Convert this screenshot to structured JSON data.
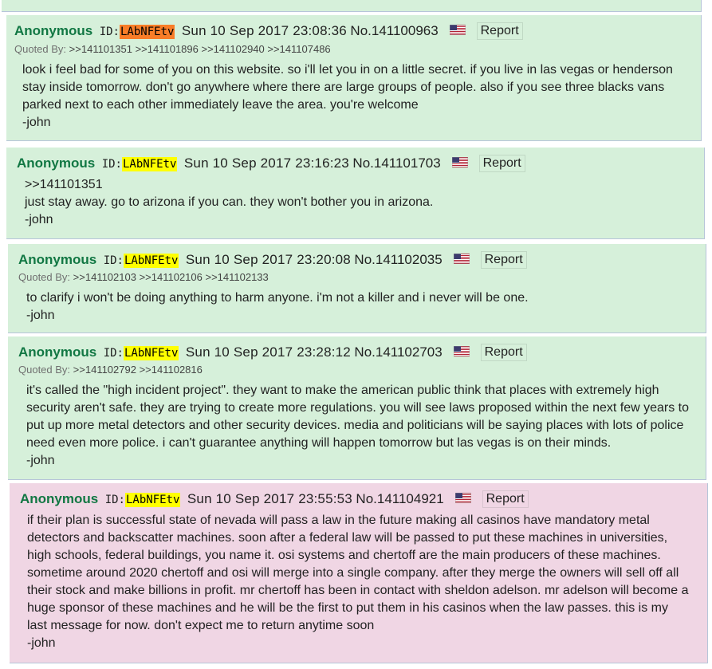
{
  "colors": {
    "post_bg_green": "#d6f0da",
    "post_bg_pink": "#f0d6e4",
    "name_green": "#117743",
    "id_orange": "#f97d28",
    "id_yellow": "#ffff00"
  },
  "posts": [
    {
      "name": "Anonymous",
      "id_label": "ID:",
      "id": "LAbNFEtv",
      "datetime": "Sun 10 Sep 2017 23:08:36",
      "post_no": "No.141100963",
      "flag_icon": "us-flag-icon",
      "report_label": "Report",
      "quoted_by_label": "Quoted By:",
      "quoted_by": ">>141101351 >>141101896 >>141102940 >>141107486",
      "lines": [
        "look i feel bad for some of you on this website. so i'll let you in on a little secret. if you live in las vegas or henderson",
        "stay inside tomorrow. don't go anywhere where there are large groups of people. also if you see three blacks vans",
        "parked next to each other immediately leave the area. you're welcome",
        "-john"
      ]
    },
    {
      "name": "Anonymous",
      "id_label": "ID:",
      "id": "LAbNFEtv",
      "datetime": "Sun 10 Sep 2017 23:16:23",
      "post_no": "No.141101703",
      "flag_icon": "us-flag-icon",
      "report_label": "Report",
      "quote_link": ">>141101351",
      "lines": [
        "just stay away. go to arizona if you can. they won't bother you in arizona.",
        "-john"
      ]
    },
    {
      "name": "Anonymous",
      "id_label": "ID:",
      "id": "LAbNFEtv",
      "datetime": "Sun 10 Sep 2017 23:20:08",
      "post_no": "No.141102035",
      "flag_icon": "us-flag-icon",
      "report_label": "Report",
      "quoted_by_label": "Quoted By:",
      "quoted_by": ">>141102103 >>141102106 >>141102133",
      "lines": [
        "to clarify i won't be doing anything to harm anyone. i'm not a killer and i never will be one.",
        "-john"
      ]
    },
    {
      "name": "Anonymous",
      "id_label": "ID:",
      "id": "LAbNFEtv",
      "datetime": "Sun 10 Sep 2017 23:28:12",
      "post_no": "No.141102703",
      "flag_icon": "us-flag-icon",
      "report_label": "Report",
      "quoted_by_label": "Quoted By:",
      "quoted_by": ">>141102792 >>141102816",
      "lines": [
        "it's called the \"high incident project\". they want to make the american public think that places with extremely high",
        "security aren't safe. they are trying to create more regulations. you will see laws proposed within the next few years to",
        "put up more metal detectors and other security devices. media and politicians will be saying places with lots of police",
        "need even more police. i can't guarantee anything will happen tomorrow but las vegas is on their minds.",
        "-john"
      ]
    },
    {
      "name": "Anonymous",
      "id_label": "ID:",
      "id": "LAbNFEtv",
      "datetime": "Sun 10 Sep 2017 23:55:53",
      "post_no": "No.141104921",
      "flag_icon": "us-flag-icon",
      "report_label": "Report",
      "lines": [
        "if their plan is successful state of nevada will pass a law in the future making all casinos have mandatory metal",
        "detectors and backscatter machines. soon after a federal law will be passed to put these machines in universities,",
        "high schools, federal buildings, you name it. osi systems and chertoff are the main producers of these machines.",
        "sometime around 2020 chertoff and osi will merge into a single company. after they merge the owners will sell off all",
        "their stock and make billions in profit. mr chertoff has been in contact with sheldon adelson. mr adelson will become a",
        "huge sponsor of these machines and he will be the first to put them in his casinos when the law passes. this is my",
        "last message for now. don't expect me to return anytime soon",
        "-john"
      ]
    }
  ]
}
